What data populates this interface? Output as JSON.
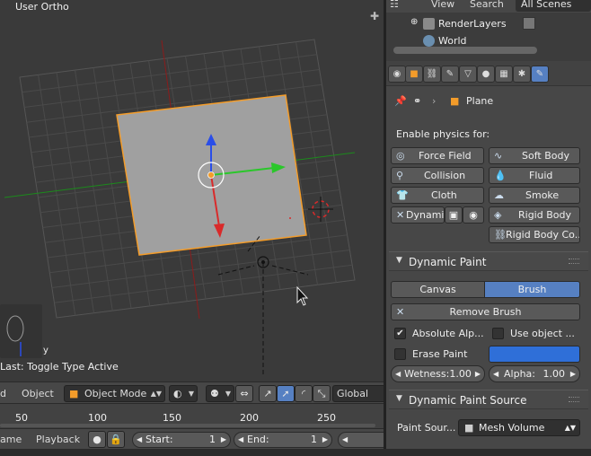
{
  "viewport": {
    "title": "User Ortho",
    "last_op": "Last: Toggle Type Active",
    "header": {
      "menu_left": "d",
      "object_menu": "Object",
      "mode": "Object Mode",
      "orientation": "Global"
    }
  },
  "timeline": {
    "ticks": [
      "50",
      "100",
      "150",
      "200",
      "250"
    ],
    "footer": {
      "left_cut": "ame",
      "playback": "Playback",
      "start_label": "Start:",
      "start_value": "1",
      "end_label": "End:",
      "end_value": "1"
    }
  },
  "outliner": {
    "menu": [
      "View",
      "Search"
    ],
    "scenes": "All Scenes",
    "rows": [
      "RenderLayers",
      "World"
    ]
  },
  "properties": {
    "object_name": "Plane",
    "enable_physics_label": "Enable physics for:",
    "physics_buttons": {
      "force_field": "Force Field",
      "soft_body": "Soft Body",
      "collision": "Collision",
      "fluid": "Fluid",
      "cloth": "Cloth",
      "smoke": "Smoke",
      "dynamic": "Dynami",
      "rigid_body": "Rigid Body",
      "rigid_body_constraint": "Rigid Body Co..."
    },
    "dynamic_paint": {
      "title": "Dynamic Paint",
      "tab_canvas": "Canvas",
      "tab_brush": "Brush",
      "remove_brush": "Remove Brush",
      "absolute_alpha": "Absolute Alp...",
      "use_object": "Use object ...",
      "erase_paint": "Erase Paint",
      "wetness_label": "Wetness:",
      "wetness_value": "1.00",
      "alpha_label": "Alpha:",
      "alpha_value": "1.00",
      "brush_color": "#2f6fd8"
    },
    "dynamic_paint_source": {
      "title": "Dynamic Paint Source",
      "paint_source_label": "Paint Sour...",
      "paint_source_value": "Mesh Volume"
    }
  },
  "colors": {
    "selection": "#5680c2",
    "object_outline": "#f39c2a"
  }
}
